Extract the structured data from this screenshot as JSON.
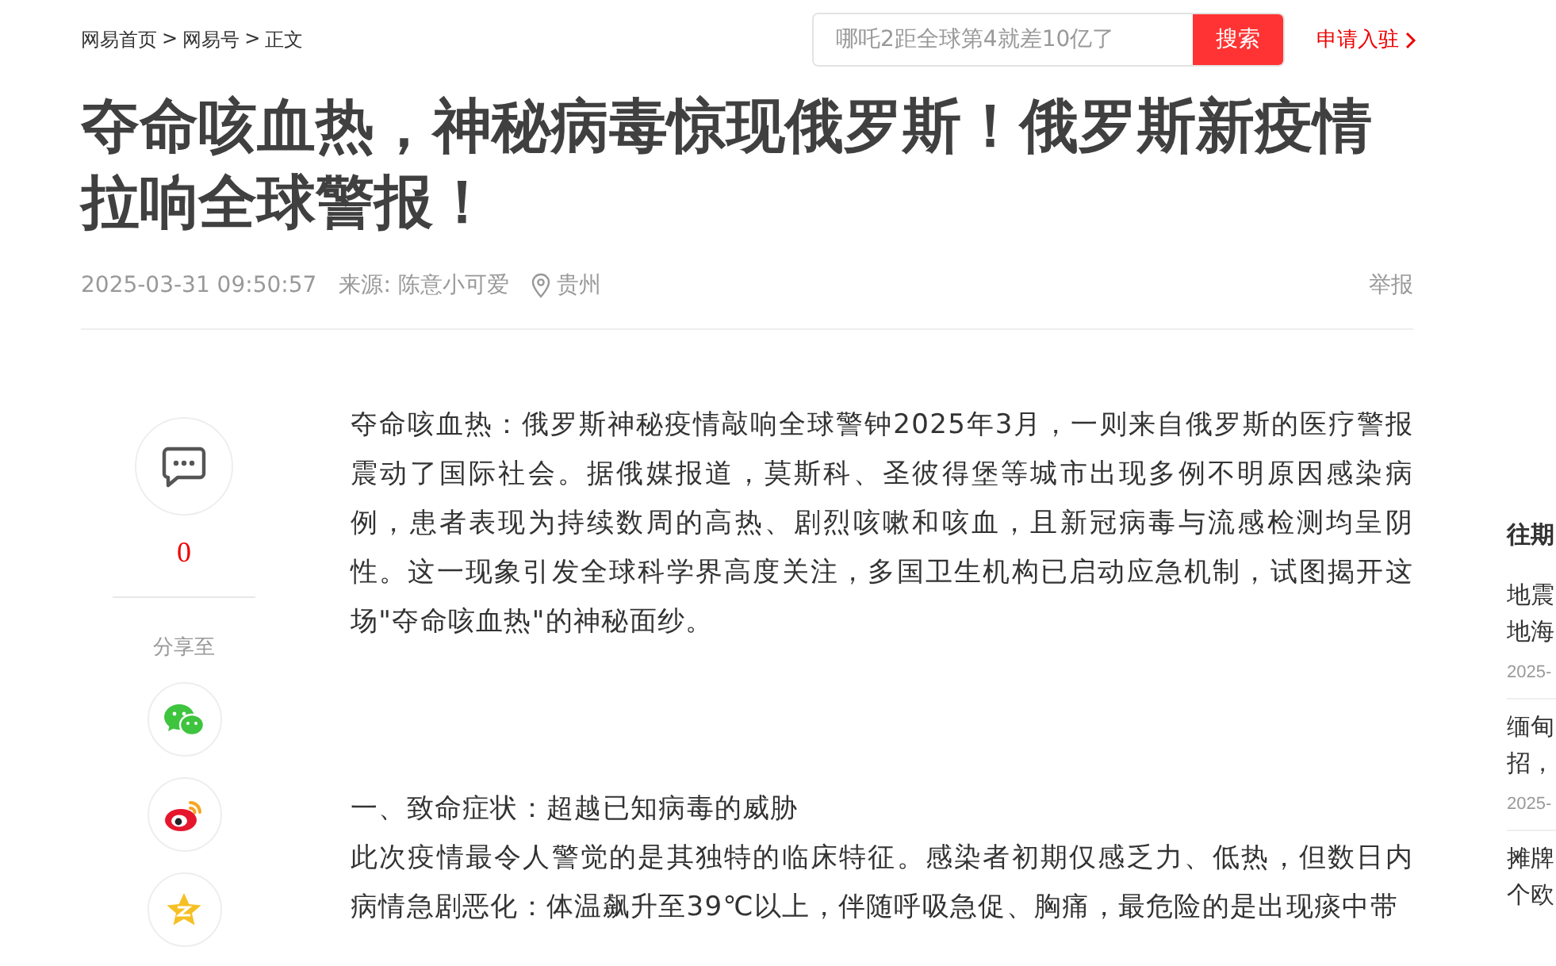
{
  "breadcrumb": [
    "网易首页",
    ">",
    "网易号",
    ">",
    "正文"
  ],
  "search": {
    "placeholder": "哪吒2距全球第4就差10亿了",
    "button": "搜索"
  },
  "join_link": "申请入驻",
  "title": "夺命咳血热，神秘病毒惊现俄罗斯！俄罗斯新疫情拉响全球警报！",
  "meta": {
    "time": "2025-03-31 09:50:57",
    "source": "来源: 陈意小可爱",
    "location": "贵州",
    "report": "举报"
  },
  "rail": {
    "comment_count": "0",
    "share_label": "分享至",
    "shares": [
      {
        "kind": "wechat"
      },
      {
        "kind": "weibo"
      },
      {
        "kind": "qzone"
      }
    ]
  },
  "article": [
    {
      "kind": "text",
      "text": "夺命咳血热：俄罗斯神秘疫情敲响全球警钟2025年3月，一则来自俄罗斯的医疗警报震动了国际社会。据俄媒报道，莫斯科、圣彼得堡等城市出现多例不明原因感染病例，患者表现为持续数周的高热、剧烈咳嗽和咳血，且新冠病毒与流感检测均呈阴性。这一现象引发全球科学界高度关注，多国卫生机构已启动应急机制，试图揭开这场\"夺命咳血热\"的神秘面纱。"
    },
    {
      "kind": "heading",
      "text": "一、致命症状：超越已知病毒的威胁"
    },
    {
      "kind": "text",
      "text": "此次疫情最令人警觉的是其独特的临床特征。感染者初期仅感乏力、低热，但数日内病情急剧恶化：体温飙升至39℃以上，伴随呼吸急促、胸痛，最危险的是出现痰中带"
    }
  ],
  "sidebar": {
    "title": "往期",
    "items": [
      {
        "lines": [
          "地震",
          "地海"
        ],
        "date": "2025-"
      },
      {
        "lines": [
          "缅甸",
          "招，"
        ],
        "date": "2025-"
      },
      {
        "lines": [
          "摊牌",
          "个欧"
        ]
      }
    ]
  }
}
